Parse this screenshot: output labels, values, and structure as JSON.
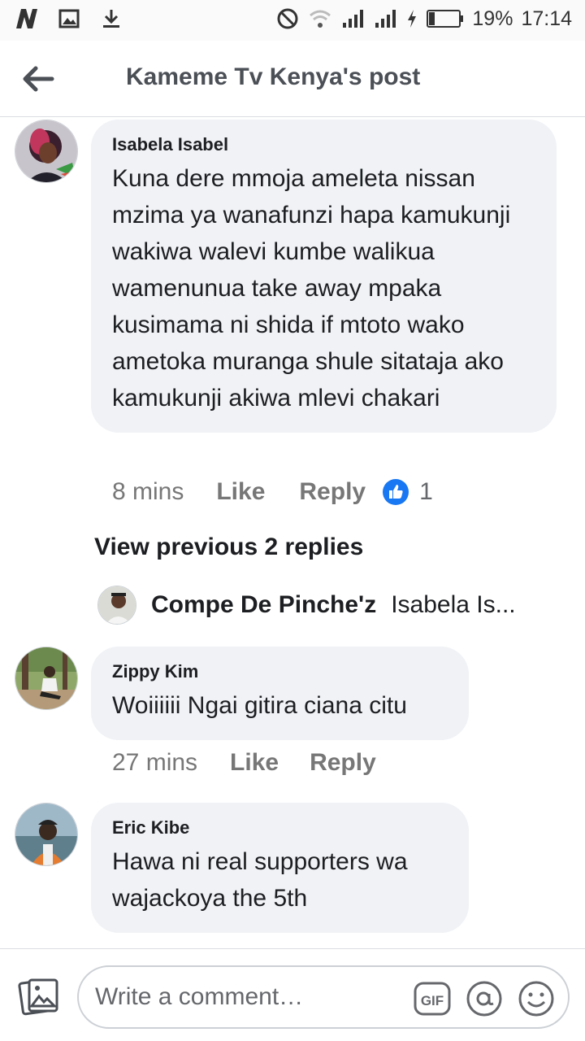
{
  "status_bar": {
    "icons_left": [
      "n-app-icon",
      "gallery-icon",
      "download-icon"
    ],
    "icons_right": [
      "dnd-icon",
      "wifi-icon",
      "signal-icon",
      "signal-icon",
      "charging-icon",
      "battery-icon"
    ],
    "battery": "19%",
    "time": "17:14"
  },
  "header": {
    "title": "Kameme Tv Kenya's post"
  },
  "comments": [
    {
      "author": "Isabela Isabel",
      "text": "Kuna dere mmoja ameleta nissan mzima ya wanafunzi hapa kamukunji wakiwa walevi kumbe walikua wamenunua take away mpaka kusimama ni shida if mtoto wako ametoka muranga shule sitataja ako kamukunji akiwa mlevi chakari",
      "time": "8 mins",
      "like": "Like",
      "reply": "Reply",
      "reactions": "1"
    },
    {
      "author": "Zippy Kim",
      "text": "Woiiiiii Ngai gitira ciana citu",
      "time": "27 mins",
      "like": "Like",
      "reply": "Reply"
    },
    {
      "author": "Eric Kibe",
      "text": "Hawa ni real supporters wa wajackoya the 5th"
    }
  ],
  "thread": {
    "view_previous": "View previous 2 replies",
    "reply_name": "Compe De Pinche'z",
    "reply_snippet": "Isabela Is..."
  },
  "composer": {
    "placeholder": "Write a comment…",
    "gif_label": "GIF"
  },
  "colors": {
    "bubble": "#f0f2f5",
    "like_blue": "#1877f2",
    "header_text": "#4b4f56"
  }
}
